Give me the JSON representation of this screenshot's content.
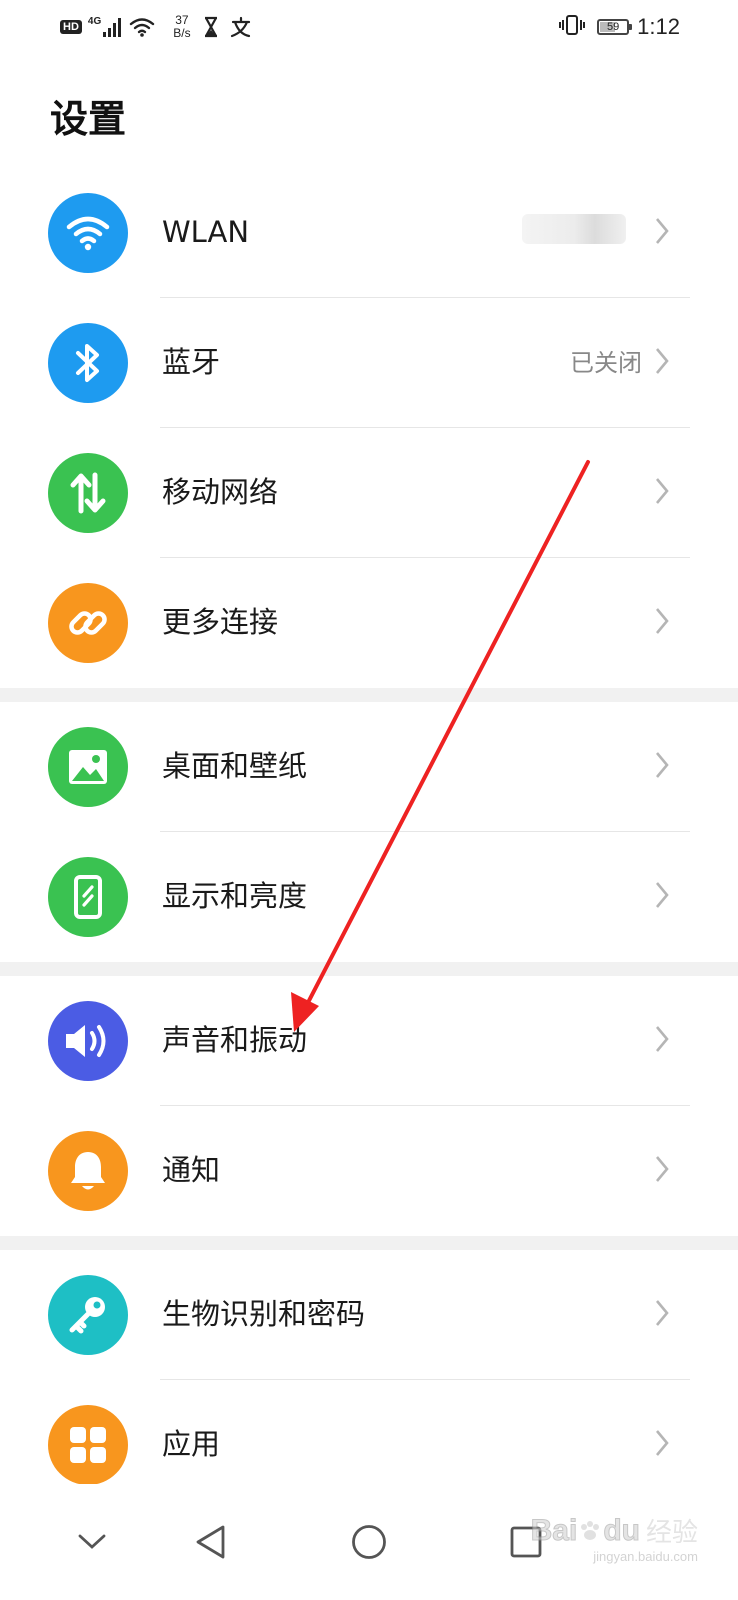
{
  "status_bar": {
    "hd_badge": "HD",
    "network_type": "4G",
    "speed_value": "37",
    "speed_unit": "B/s",
    "battery_level": "59",
    "time": "1:12"
  },
  "header": {
    "title": "设置"
  },
  "settings": [
    {
      "label": "WLAN",
      "value": "",
      "icon": "wifi-icon",
      "color": "#1e9bf0"
    },
    {
      "label": "蓝牙",
      "value": "已关闭",
      "icon": "bluetooth-icon",
      "color": "#1e9bf0"
    },
    {
      "label": "移动网络",
      "value": "",
      "icon": "mobile-data-icon",
      "color": "#3ac251"
    },
    {
      "label": "更多连接",
      "value": "",
      "icon": "link-icon",
      "color": "#f8961e"
    },
    {
      "label": "桌面和壁纸",
      "value": "",
      "icon": "wallpaper-icon",
      "color": "#3ac251"
    },
    {
      "label": "显示和亮度",
      "value": "",
      "icon": "display-icon",
      "color": "#3ac251"
    },
    {
      "label": "声音和振动",
      "value": "",
      "icon": "volume-icon",
      "color": "#4b5ce4"
    },
    {
      "label": "通知",
      "value": "",
      "icon": "bell-icon",
      "color": "#f8961e"
    },
    {
      "label": "生物识别和密码",
      "value": "",
      "icon": "key-icon",
      "color": "#1ebfc5"
    },
    {
      "label": "应用",
      "value": "",
      "icon": "apps-icon",
      "color": "#f8961e"
    }
  ],
  "watermark": {
    "brand": "Bai",
    "brand2": "du",
    "suffix": "经验",
    "url": "jingyan.baidu.com"
  },
  "colors": {
    "annotation": "#ee2222",
    "divider": "#e6e6e6",
    "group_gap": "#f1f1f1"
  }
}
